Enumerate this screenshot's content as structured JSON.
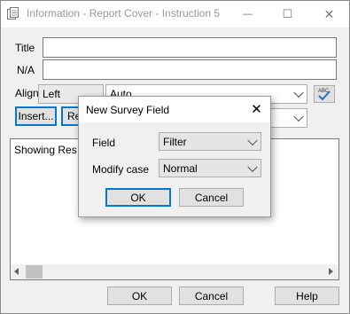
{
  "window": {
    "title": "Information - Report Cover - Instruction 5",
    "controls": {
      "minimize": "—",
      "maximize": "☐",
      "close": "✕"
    }
  },
  "form": {
    "title_label": "Title",
    "title_value": "",
    "na_label": "N/A",
    "na_value": "",
    "align_label": "Align",
    "align_value": "Left",
    "second_combo_value": "Auto",
    "insert_button": "Insert...",
    "re_button": "Re",
    "body_text": "Showing Res"
  },
  "footer": {
    "ok": "OK",
    "cancel": "Cancel",
    "help": "Help"
  },
  "dialog": {
    "title": "New Survey Field",
    "close": "✕",
    "field_label": "Field",
    "field_value": "Filter",
    "modify_case_label": "Modify case",
    "modify_case_value": "Normal",
    "ok": "OK",
    "cancel": "Cancel"
  },
  "spell_icon_text": "ABC",
  "colors": {
    "accent": "#0078d7",
    "window_bg": "#f0f0f0"
  }
}
